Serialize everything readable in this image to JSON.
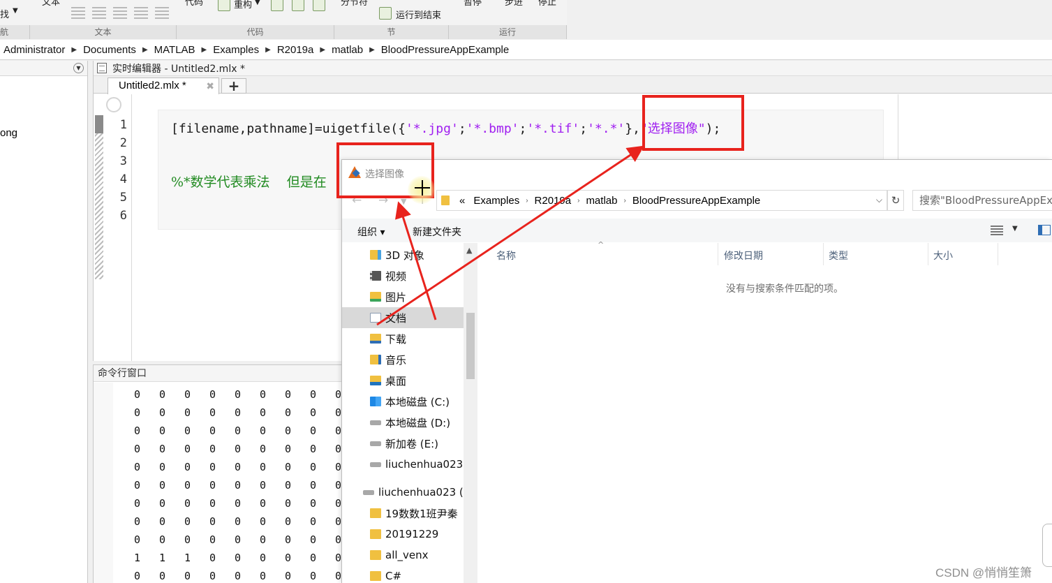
{
  "toolstrip": {
    "find_label": "找",
    "text_label_top": "文本",
    "code_label_top": "代码",
    "refactor_label": "重构",
    "section_label_top": "分节符",
    "run_to_end_label": "运行到结束",
    "pause_label": "暂停",
    "step_label": "步进",
    "stop_label": "停止",
    "groups": [
      "航",
      "文本",
      "代码",
      "节",
      "运行"
    ]
  },
  "breadcrumb": [
    "Administrator",
    "Documents",
    "MATLAB",
    "Examples",
    "R2019a",
    "matlab",
    "BloodPressureAppExample"
  ],
  "left_panel": {
    "partial_item": "ong"
  },
  "editor": {
    "window_title": "实时编辑器 - Untitled2.mlx *",
    "tab_label": "Untitled2.mlx *",
    "line_numbers": [
      "1",
      "2",
      "3",
      "4",
      "5",
      "6"
    ],
    "code": {
      "line1_a": "[filename,pathname]=uigetfile({",
      "line1_b": "'*.jpg'",
      "line1_c": ";",
      "line1_d": "'*.bmp'",
      "line1_e": ";",
      "line1_f": "'*.tif'",
      "line1_g": ";",
      "line1_h": "'*.*'",
      "line1_i": "},",
      "line1_j": "\"选择图像\"",
      "line1_k": ");",
      "line4": "%*数学代表乘法    但是在"
    }
  },
  "command_window": {
    "title": "命令行窗口",
    "rows": [
      [
        "0",
        "0",
        "0",
        "0",
        "0",
        "0",
        "0",
        "0",
        "0"
      ],
      [
        "0",
        "0",
        "0",
        "0",
        "0",
        "0",
        "0",
        "0",
        "0"
      ],
      [
        "0",
        "0",
        "0",
        "0",
        "0",
        "0",
        "0",
        "0",
        "0"
      ],
      [
        "0",
        "0",
        "0",
        "0",
        "0",
        "0",
        "0",
        "0",
        "0"
      ],
      [
        "0",
        "0",
        "0",
        "0",
        "0",
        "0",
        "0",
        "0",
        "0"
      ],
      [
        "0",
        "0",
        "0",
        "0",
        "0",
        "0",
        "0",
        "0",
        "0"
      ],
      [
        "0",
        "0",
        "0",
        "0",
        "0",
        "0",
        "0",
        "0",
        "0"
      ],
      [
        "0",
        "0",
        "0",
        "0",
        "0",
        "0",
        "0",
        "0",
        "0"
      ],
      [
        "0",
        "0",
        "0",
        "0",
        "0",
        "0",
        "0",
        "0",
        "0"
      ],
      [
        "1",
        "1",
        "1",
        "0",
        "0",
        "0",
        "0",
        "0",
        "0"
      ],
      [
        "0",
        "0",
        "0",
        "0",
        "0",
        "0",
        "0",
        "0",
        "0"
      ]
    ]
  },
  "dialog": {
    "title": "选择图像",
    "path_prefix": "«",
    "path": [
      "Examples",
      "R2019a",
      "matlab",
      "BloodPressureAppExample"
    ],
    "search_placeholder": "搜索\"BloodPressureAppEx",
    "organize_label": "组织 ▾",
    "new_folder_label": "新建文件夹",
    "nav_items": [
      {
        "label": "3D 对象",
        "icon": "3d-objects-icon"
      },
      {
        "label": "视频",
        "icon": "video-icon"
      },
      {
        "label": "图片",
        "icon": "pictures-icon"
      },
      {
        "label": "文档",
        "icon": "documents-icon"
      },
      {
        "label": "下载",
        "icon": "downloads-icon"
      },
      {
        "label": "音乐",
        "icon": "music-icon"
      },
      {
        "label": "桌面",
        "icon": "desktop-icon"
      },
      {
        "label": "本地磁盘 (C:)",
        "icon": "windows-drive-icon"
      },
      {
        "label": "本地磁盘 (D:)",
        "icon": "drive-icon"
      },
      {
        "label": "新加卷 (E:)",
        "icon": "drive-icon"
      },
      {
        "label": "liuchenhua023",
        "icon": "drive-icon"
      },
      {
        "label": "liuchenhua023 (",
        "icon": "network-drive-icon"
      },
      {
        "label": "19数数1班尹秦",
        "icon": "folder-icon"
      },
      {
        "label": "20191229",
        "icon": "folder-icon"
      },
      {
        "label": "all_venx",
        "icon": "folder-icon"
      },
      {
        "label": "C#",
        "icon": "folder-icon"
      }
    ],
    "selected_nav": "文档",
    "columns": [
      "名称",
      "修改日期",
      "类型",
      "大小"
    ],
    "empty_message": "没有与搜索条件匹配的项。"
  },
  "watermark": "CSDN @悄悄笙箫",
  "colors": {
    "annotation": "#e8231d",
    "string": "#a020f0",
    "comment": "#228b22"
  }
}
